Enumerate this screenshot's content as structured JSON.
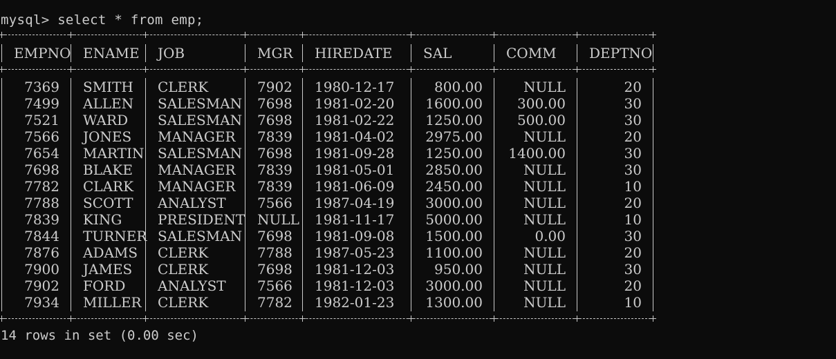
{
  "prompt": "mysql>",
  "command": "select * from emp;",
  "table": {
    "columns": [
      "EMPNO",
      "ENAME",
      "JOB",
      "MGR",
      "HIREDATE",
      "SAL",
      "COMM",
      "DEPTNO"
    ],
    "rows": [
      [
        "7369",
        "SMITH",
        "CLERK",
        "7902",
        "1980-12-17",
        "800.00",
        "NULL",
        "20"
      ],
      [
        "7499",
        "ALLEN",
        "SALESMAN",
        "7698",
        "1981-02-20",
        "1600.00",
        "300.00",
        "30"
      ],
      [
        "7521",
        "WARD",
        "SALESMAN",
        "7698",
        "1981-02-22",
        "1250.00",
        "500.00",
        "30"
      ],
      [
        "7566",
        "JONES",
        "MANAGER",
        "7839",
        "1981-04-02",
        "2975.00",
        "NULL",
        "20"
      ],
      [
        "7654",
        "MARTIN",
        "SALESMAN",
        "7698",
        "1981-09-28",
        "1250.00",
        "1400.00",
        "30"
      ],
      [
        "7698",
        "BLAKE",
        "MANAGER",
        "7839",
        "1981-05-01",
        "2850.00",
        "NULL",
        "30"
      ],
      [
        "7782",
        "CLARK",
        "MANAGER",
        "7839",
        "1981-06-09",
        "2450.00",
        "NULL",
        "10"
      ],
      [
        "7788",
        "SCOTT",
        "ANALYST",
        "7566",
        "1987-04-19",
        "3000.00",
        "NULL",
        "20"
      ],
      [
        "7839",
        "KING",
        "PRESIDENT",
        "NULL",
        "1981-11-17",
        "5000.00",
        "NULL",
        "10"
      ],
      [
        "7844",
        "TURNER",
        "SALESMAN",
        "7698",
        "1981-09-08",
        "1500.00",
        "0.00",
        "30"
      ],
      [
        "7876",
        "ADAMS",
        "CLERK",
        "7788",
        "1987-05-23",
        "1100.00",
        "NULL",
        "20"
      ],
      [
        "7900",
        "JAMES",
        "CLERK",
        "7698",
        "1981-12-03",
        "950.00",
        "NULL",
        "30"
      ],
      [
        "7902",
        "FORD",
        "ANALYST",
        "7566",
        "1981-12-03",
        "3000.00",
        "NULL",
        "20"
      ],
      [
        "7934",
        "MILLER",
        "CLERK",
        "7782",
        "1982-01-23",
        "1300.00",
        "NULL",
        "10"
      ]
    ]
  },
  "summary": "14 rows in set (0.00 sec)",
  "colors": {
    "background": "#0c0c0c",
    "text": "#cccccc"
  }
}
